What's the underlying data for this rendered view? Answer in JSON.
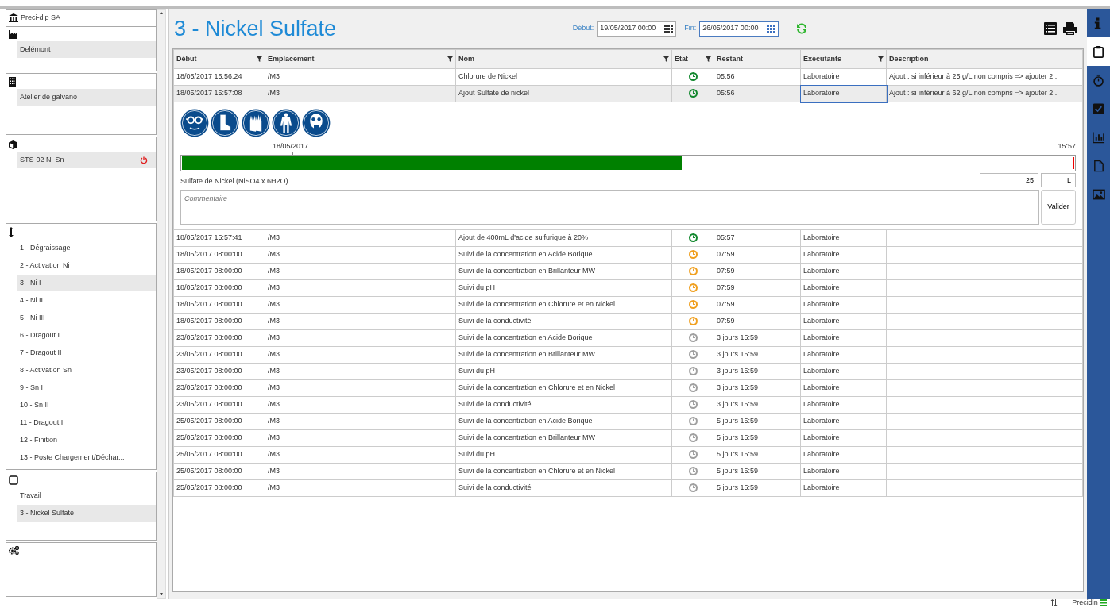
{
  "sidebar": {
    "sections": [
      {
        "kind": "company",
        "title": "Preci-dip SA"
      },
      {
        "kind": "site",
        "items": [
          {
            "label": "Delémont",
            "selected": true,
            "power_button": false
          }
        ]
      },
      {
        "kind": "building",
        "items": [
          {
            "label": "Atelier de galvano",
            "selected": true,
            "power_button": false
          }
        ]
      },
      {
        "kind": "machine",
        "items": [
          {
            "label": "STS-02 Ni-Sn",
            "selected": true,
            "power_button": true
          }
        ]
      },
      {
        "kind": "bath",
        "items": [
          {
            "label": "1 - Dégraissage",
            "selected": false,
            "power_button": false
          },
          {
            "label": "2 - Activation Ni",
            "selected": false,
            "power_button": false
          },
          {
            "label": "3 - Ni I",
            "selected": true,
            "power_button": false
          },
          {
            "label": "4 - Ni II",
            "selected": false,
            "power_button": false
          },
          {
            "label": "5 - Ni III",
            "selected": false,
            "power_button": false
          },
          {
            "label": "6 - Dragout I",
            "selected": false,
            "power_button": false
          },
          {
            "label": "7 - Dragout II",
            "selected": false,
            "power_button": false
          },
          {
            "label": "8 - Activation Sn",
            "selected": false,
            "power_button": false
          },
          {
            "label": "9 - Sn I",
            "selected": false,
            "power_button": false
          },
          {
            "label": "10 - Sn II",
            "selected": false,
            "power_button": false
          },
          {
            "label": "11 - Dragout I",
            "selected": false,
            "power_button": false
          },
          {
            "label": "12 - Finition",
            "selected": false,
            "power_button": false
          },
          {
            "label": "13 - Poste Chargement/Déchar...",
            "selected": false,
            "power_button": false
          }
        ]
      },
      {
        "kind": "task",
        "items": [
          {
            "label": "Travail",
            "selected": false,
            "power_button": false
          },
          {
            "label": "3 - Nickel Sulfate",
            "selected": true,
            "power_button": false
          }
        ]
      },
      {
        "kind": "settings"
      }
    ]
  },
  "header": {
    "title": "3 - Nickel Sulfate",
    "start": {
      "label": "Début:",
      "value": "19/05/2017 00:00"
    },
    "end": {
      "label": "Fin:",
      "value": "26/05/2017 00:00"
    }
  },
  "table": {
    "columns": [
      {
        "label": "Début",
        "filter": true
      },
      {
        "label": "Emplacement",
        "filter": true
      },
      {
        "label": "Nom",
        "filter": true
      },
      {
        "label": "Etat",
        "filter": true
      },
      {
        "label": "Restant",
        "filter": false
      },
      {
        "label": "Exécutants",
        "filter": true
      },
      {
        "label": "Description",
        "filter": false
      }
    ],
    "rows": [
      {
        "start": "18/05/2017 15:56:24",
        "location": "/M3",
        "name": "Chlorure de Nickel",
        "color": "#12882e",
        "remaining": "05:56",
        "executor": "Laboratoire",
        "description": "Ajout : si inférieur à 25 g/L non compris => ajouter 2...",
        "selected": false
      },
      {
        "start": "18/05/2017 15:57:08",
        "location": "/M3",
        "name": "Ajout Sulfate de nickel",
        "color": "#12882e",
        "remaining": "05:56",
        "executor": "Laboratoire",
        "description": "Ajout : si inférieur à 62 g/L non compris => ajouter 2...",
        "selected": true,
        "detail": {
          "ppe": [
            {
              "kind": "goggles"
            },
            {
              "kind": "boots"
            },
            {
              "kind": "gloves"
            },
            {
              "kind": "suit"
            },
            {
              "kind": "respirator"
            }
          ],
          "timeline": {
            "start_label": "18/05/2017",
            "end_label": "15:57",
            "level": 0.56
          },
          "product": "Sulfate de Nickel (NiSO4 x 6H2O)",
          "quantity": "25",
          "unit": "L",
          "comment": {
            "placeholder": "Commentaire"
          },
          "button": "Valider"
        }
      },
      {
        "start": "18/05/2017 15:57:41",
        "location": "/M3",
        "name": "Ajout de 400mL d'acide sulfurique à 20%",
        "color": "#12882e",
        "remaining": "05:57",
        "executor": "Laboratoire",
        "selected": false
      },
      {
        "start": "18/05/2017 08:00:00",
        "location": "/M3",
        "name": "Suivi de la concentration en Acide Borique",
        "color": "#f0a020",
        "remaining": "07:59",
        "executor": "Laboratoire",
        "selected": false
      },
      {
        "start": "18/05/2017 08:00:00",
        "location": "/M3",
        "name": "Suivi de la concentration en Brillanteur MW",
        "color": "#f0a020",
        "remaining": "07:59",
        "executor": "Laboratoire",
        "selected": false
      },
      {
        "start": "18/05/2017 08:00:00",
        "location": "/M3",
        "name": "Suivi du pH",
        "color": "#f0a020",
        "remaining": "07:59",
        "executor": "Laboratoire",
        "selected": false
      },
      {
        "start": "18/05/2017 08:00:00",
        "location": "/M3",
        "name": "Suivi de la concentration en Chlorure et en Nickel",
        "color": "#f0a020",
        "remaining": "07:59",
        "executor": "Laboratoire",
        "selected": false
      },
      {
        "start": "18/05/2017 08:00:00",
        "location": "/M3",
        "name": "Suivi de la conductivité",
        "color": "#f0a020",
        "remaining": "07:59",
        "executor": "Laboratoire",
        "selected": false
      },
      {
        "start": "23/05/2017 08:00:00",
        "location": "/M3",
        "name": "Suivi de la concentration en Acide Borique",
        "color": "#a0a0a0",
        "remaining": "3 jours 15:59",
        "executor": "Laboratoire",
        "selected": false
      },
      {
        "start": "23/05/2017 08:00:00",
        "location": "/M3",
        "name": "Suivi de la concentration en Brillanteur MW",
        "color": "#a0a0a0",
        "remaining": "3 jours 15:59",
        "executor": "Laboratoire",
        "selected": false
      },
      {
        "start": "23/05/2017 08:00:00",
        "location": "/M3",
        "name": "Suivi du pH",
        "color": "#a0a0a0",
        "remaining": "3 jours 15:59",
        "executor": "Laboratoire",
        "selected": false
      },
      {
        "start": "23/05/2017 08:00:00",
        "location": "/M3",
        "name": "Suivi de la concentration en Chlorure et en Nickel",
        "color": "#a0a0a0",
        "remaining": "3 jours 15:59",
        "executor": "Laboratoire",
        "selected": false
      },
      {
        "start": "23/05/2017 08:00:00",
        "location": "/M3",
        "name": "Suivi de la conductivité",
        "color": "#a0a0a0",
        "remaining": "3 jours 15:59",
        "executor": "Laboratoire",
        "selected": false
      },
      {
        "start": "25/05/2017 08:00:00",
        "location": "/M3",
        "name": "Suivi de la concentration en Acide Borique",
        "color": "#a0a0a0",
        "remaining": "5 jours 15:59",
        "executor": "Laboratoire",
        "selected": false
      },
      {
        "start": "25/05/2017 08:00:00",
        "location": "/M3",
        "name": "Suivi de la concentration en Brillanteur MW",
        "color": "#a0a0a0",
        "remaining": "5 jours 15:59",
        "executor": "Laboratoire",
        "selected": false
      },
      {
        "start": "25/05/2017 08:00:00",
        "location": "/M3",
        "name": "Suivi du pH",
        "color": "#a0a0a0",
        "remaining": "5 jours 15:59",
        "executor": "Laboratoire",
        "selected": false
      },
      {
        "start": "25/05/2017 08:00:00",
        "location": "/M3",
        "name": "Suivi de la concentration en Chlorure et en Nickel",
        "color": "#a0a0a0",
        "remaining": "5 jours 15:59",
        "executor": "Laboratoire",
        "selected": false
      },
      {
        "start": "25/05/2017 08:00:00",
        "location": "/M3",
        "name": "Suivi de la conductivité",
        "color": "#a0a0a0",
        "remaining": "5 jours 15:59",
        "executor": "Laboratoire",
        "selected": false
      }
    ]
  },
  "right_bar": [
    {
      "kind": "info",
      "selected": false
    },
    {
      "kind": "clipboard",
      "selected": true
    },
    {
      "kind": "stopwatch",
      "selected": false
    },
    {
      "kind": "check",
      "selected": false
    },
    {
      "kind": "chart",
      "selected": false
    },
    {
      "kind": "document",
      "selected": false
    },
    {
      "kind": "image",
      "selected": false
    }
  ],
  "status_bar": {
    "text": "Precidin"
  }
}
